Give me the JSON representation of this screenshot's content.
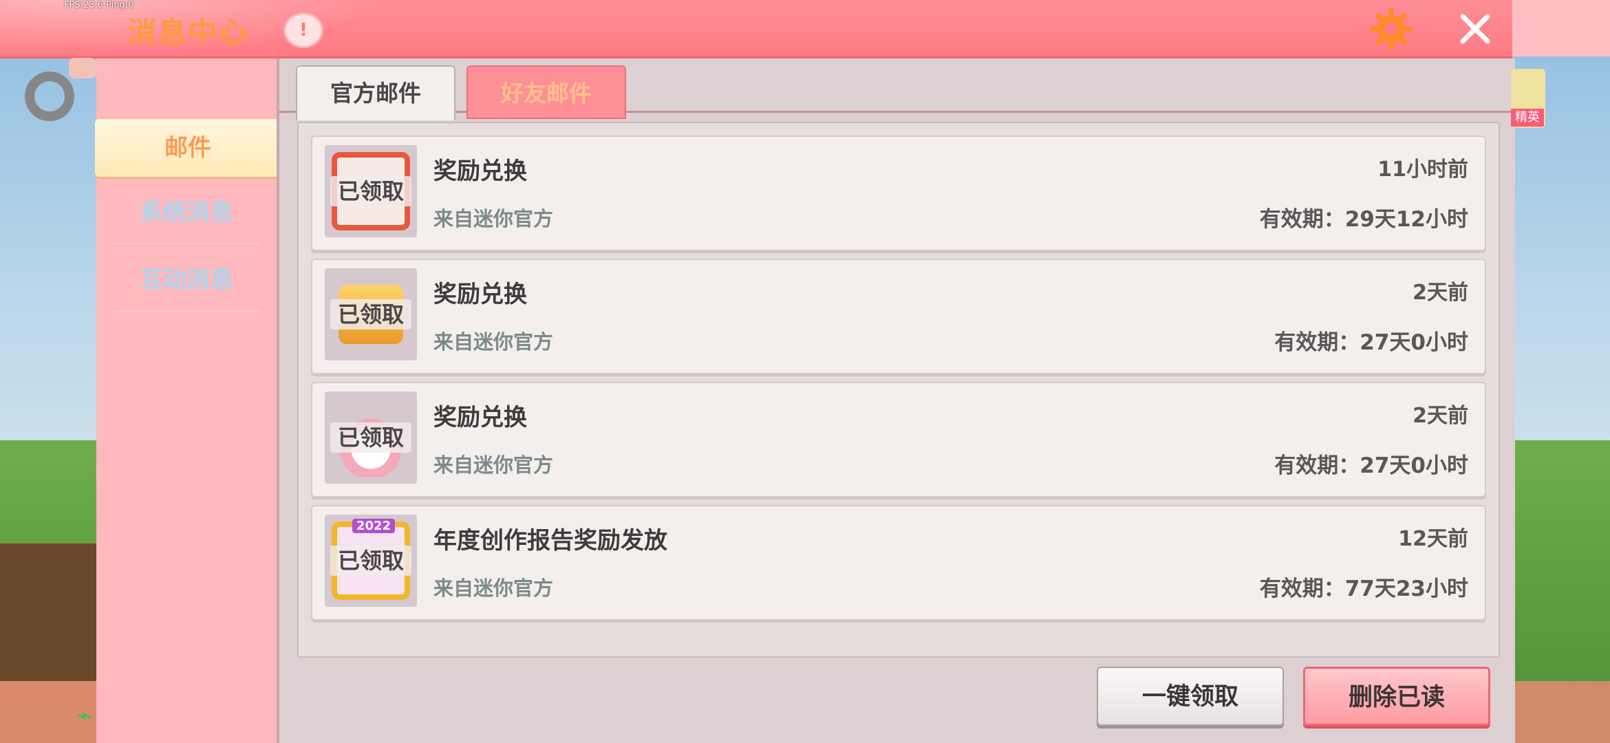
{
  "debug": {
    "fps_text": "FPS:23.6  Ping:0"
  },
  "header": {
    "title": "消息中心",
    "info_label": "!",
    "gear_icon": "gear-icon",
    "close_icon": "close-icon"
  },
  "sidebar": {
    "items": [
      {
        "label": "邮件",
        "active": true
      },
      {
        "label": "系统消息",
        "active": false
      },
      {
        "label": "互动消息",
        "active": false
      }
    ]
  },
  "tabs": [
    {
      "label": "官方邮件",
      "active": true
    },
    {
      "label": "好友邮件",
      "active": false
    }
  ],
  "mails": [
    {
      "title": "奖励兑换",
      "from": "来自迷你官方",
      "time": "11小时前",
      "validity": "有效期：29天12小时",
      "status": "已领取",
      "icon": "avatar-frame-icon"
    },
    {
      "title": "奖励兑换",
      "from": "来自迷你官方",
      "time": "2天前",
      "validity": "有效期：27天0小时",
      "status": "已领取",
      "icon": "gift-box-icon"
    },
    {
      "title": "奖励兑换",
      "from": "来自迷你官方",
      "time": "2天前",
      "validity": "有效期：27天0小时",
      "status": "已领取",
      "icon": "bunny-hat-icon"
    },
    {
      "title": "年度创作报告奖励发放",
      "from": "来自迷你官方",
      "time": "12天前",
      "validity": "有效期：77天23小时",
      "status": "已领取",
      "icon": "frame-2022-icon",
      "badge": "2022"
    }
  ],
  "actions": {
    "claim_all": "一键领取",
    "delete_read": "删除已读"
  },
  "overlay": {
    "right_tag": "精英"
  },
  "colors": {
    "header": "#ff7b84",
    "sidebar": "#ffb8be",
    "accent_orange": "#ff9a55",
    "inactive_blue": "#a9d6ee"
  }
}
